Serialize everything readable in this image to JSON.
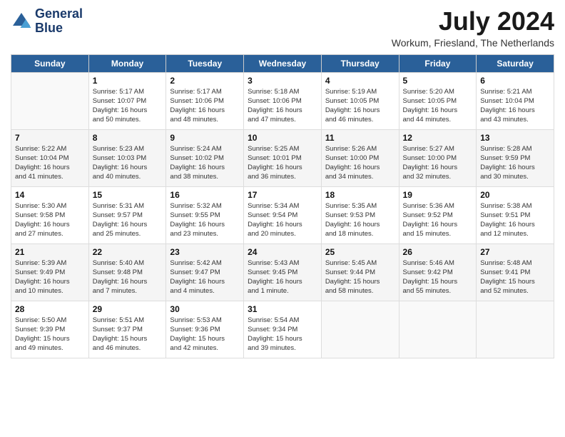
{
  "header": {
    "logo_line1": "General",
    "logo_line2": "Blue",
    "month_year": "July 2024",
    "location": "Workum, Friesland, The Netherlands"
  },
  "days_of_week": [
    "Sunday",
    "Monday",
    "Tuesday",
    "Wednesday",
    "Thursday",
    "Friday",
    "Saturday"
  ],
  "weeks": [
    [
      {
        "day": "",
        "info": ""
      },
      {
        "day": "1",
        "info": "Sunrise: 5:17 AM\nSunset: 10:07 PM\nDaylight: 16 hours\nand 50 minutes."
      },
      {
        "day": "2",
        "info": "Sunrise: 5:17 AM\nSunset: 10:06 PM\nDaylight: 16 hours\nand 48 minutes."
      },
      {
        "day": "3",
        "info": "Sunrise: 5:18 AM\nSunset: 10:06 PM\nDaylight: 16 hours\nand 47 minutes."
      },
      {
        "day": "4",
        "info": "Sunrise: 5:19 AM\nSunset: 10:05 PM\nDaylight: 16 hours\nand 46 minutes."
      },
      {
        "day": "5",
        "info": "Sunrise: 5:20 AM\nSunset: 10:05 PM\nDaylight: 16 hours\nand 44 minutes."
      },
      {
        "day": "6",
        "info": "Sunrise: 5:21 AM\nSunset: 10:04 PM\nDaylight: 16 hours\nand 43 minutes."
      }
    ],
    [
      {
        "day": "7",
        "info": "Sunrise: 5:22 AM\nSunset: 10:04 PM\nDaylight: 16 hours\nand 41 minutes."
      },
      {
        "day": "8",
        "info": "Sunrise: 5:23 AM\nSunset: 10:03 PM\nDaylight: 16 hours\nand 40 minutes."
      },
      {
        "day": "9",
        "info": "Sunrise: 5:24 AM\nSunset: 10:02 PM\nDaylight: 16 hours\nand 38 minutes."
      },
      {
        "day": "10",
        "info": "Sunrise: 5:25 AM\nSunset: 10:01 PM\nDaylight: 16 hours\nand 36 minutes."
      },
      {
        "day": "11",
        "info": "Sunrise: 5:26 AM\nSunset: 10:00 PM\nDaylight: 16 hours\nand 34 minutes."
      },
      {
        "day": "12",
        "info": "Sunrise: 5:27 AM\nSunset: 10:00 PM\nDaylight: 16 hours\nand 32 minutes."
      },
      {
        "day": "13",
        "info": "Sunrise: 5:28 AM\nSunset: 9:59 PM\nDaylight: 16 hours\nand 30 minutes."
      }
    ],
    [
      {
        "day": "14",
        "info": "Sunrise: 5:30 AM\nSunset: 9:58 PM\nDaylight: 16 hours\nand 27 minutes."
      },
      {
        "day": "15",
        "info": "Sunrise: 5:31 AM\nSunset: 9:57 PM\nDaylight: 16 hours\nand 25 minutes."
      },
      {
        "day": "16",
        "info": "Sunrise: 5:32 AM\nSunset: 9:55 PM\nDaylight: 16 hours\nand 23 minutes."
      },
      {
        "day": "17",
        "info": "Sunrise: 5:34 AM\nSunset: 9:54 PM\nDaylight: 16 hours\nand 20 minutes."
      },
      {
        "day": "18",
        "info": "Sunrise: 5:35 AM\nSunset: 9:53 PM\nDaylight: 16 hours\nand 18 minutes."
      },
      {
        "day": "19",
        "info": "Sunrise: 5:36 AM\nSunset: 9:52 PM\nDaylight: 16 hours\nand 15 minutes."
      },
      {
        "day": "20",
        "info": "Sunrise: 5:38 AM\nSunset: 9:51 PM\nDaylight: 16 hours\nand 12 minutes."
      }
    ],
    [
      {
        "day": "21",
        "info": "Sunrise: 5:39 AM\nSunset: 9:49 PM\nDaylight: 16 hours\nand 10 minutes."
      },
      {
        "day": "22",
        "info": "Sunrise: 5:40 AM\nSunset: 9:48 PM\nDaylight: 16 hours\nand 7 minutes."
      },
      {
        "day": "23",
        "info": "Sunrise: 5:42 AM\nSunset: 9:47 PM\nDaylight: 16 hours\nand 4 minutes."
      },
      {
        "day": "24",
        "info": "Sunrise: 5:43 AM\nSunset: 9:45 PM\nDaylight: 16 hours\nand 1 minute."
      },
      {
        "day": "25",
        "info": "Sunrise: 5:45 AM\nSunset: 9:44 PM\nDaylight: 15 hours\nand 58 minutes."
      },
      {
        "day": "26",
        "info": "Sunrise: 5:46 AM\nSunset: 9:42 PM\nDaylight: 15 hours\nand 55 minutes."
      },
      {
        "day": "27",
        "info": "Sunrise: 5:48 AM\nSunset: 9:41 PM\nDaylight: 15 hours\nand 52 minutes."
      }
    ],
    [
      {
        "day": "28",
        "info": "Sunrise: 5:50 AM\nSunset: 9:39 PM\nDaylight: 15 hours\nand 49 minutes."
      },
      {
        "day": "29",
        "info": "Sunrise: 5:51 AM\nSunset: 9:37 PM\nDaylight: 15 hours\nand 46 minutes."
      },
      {
        "day": "30",
        "info": "Sunrise: 5:53 AM\nSunset: 9:36 PM\nDaylight: 15 hours\nand 42 minutes."
      },
      {
        "day": "31",
        "info": "Sunrise: 5:54 AM\nSunset: 9:34 PM\nDaylight: 15 hours\nand 39 minutes."
      },
      {
        "day": "",
        "info": ""
      },
      {
        "day": "",
        "info": ""
      },
      {
        "day": "",
        "info": ""
      }
    ]
  ]
}
